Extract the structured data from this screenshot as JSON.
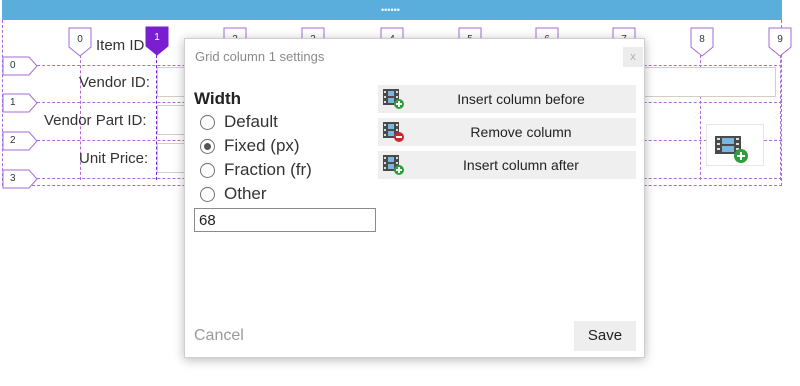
{
  "topbar": {
    "grip": "••••••"
  },
  "columns": {
    "markers": [
      "0",
      "1",
      "2",
      "3",
      "4",
      "5",
      "6",
      "7",
      "8",
      "9"
    ],
    "selected": "1"
  },
  "rows": {
    "markers": [
      "0",
      "1",
      "2",
      "3"
    ]
  },
  "form": {
    "item_id_label": "Item ID",
    "vendor_id_label": "Vendor ID:",
    "vendor_part_id_label": "Vendor Part ID:",
    "unit_price_label": "Unit Price:"
  },
  "dialog": {
    "title": "Grid column 1 settings",
    "close": "x",
    "width_heading": "Width",
    "options": [
      {
        "label": "Default",
        "checked": false
      },
      {
        "label": "Fixed (px)",
        "checked": true
      },
      {
        "label": "Fraction (fr)",
        "checked": false
      },
      {
        "label": "Other",
        "checked": false
      }
    ],
    "width_value": "68",
    "actions": {
      "insert_before": "Insert column before",
      "remove": "Remove column",
      "insert_after": "Insert column after"
    },
    "cancel": "Cancel",
    "save": "Save"
  },
  "colors": {
    "topbar": "#5aaedb",
    "grid_line": "#b26ad6",
    "selected_marker": "#7a1fd0",
    "add_badge": "#2e9e3a",
    "remove_badge": "#d3232f"
  }
}
